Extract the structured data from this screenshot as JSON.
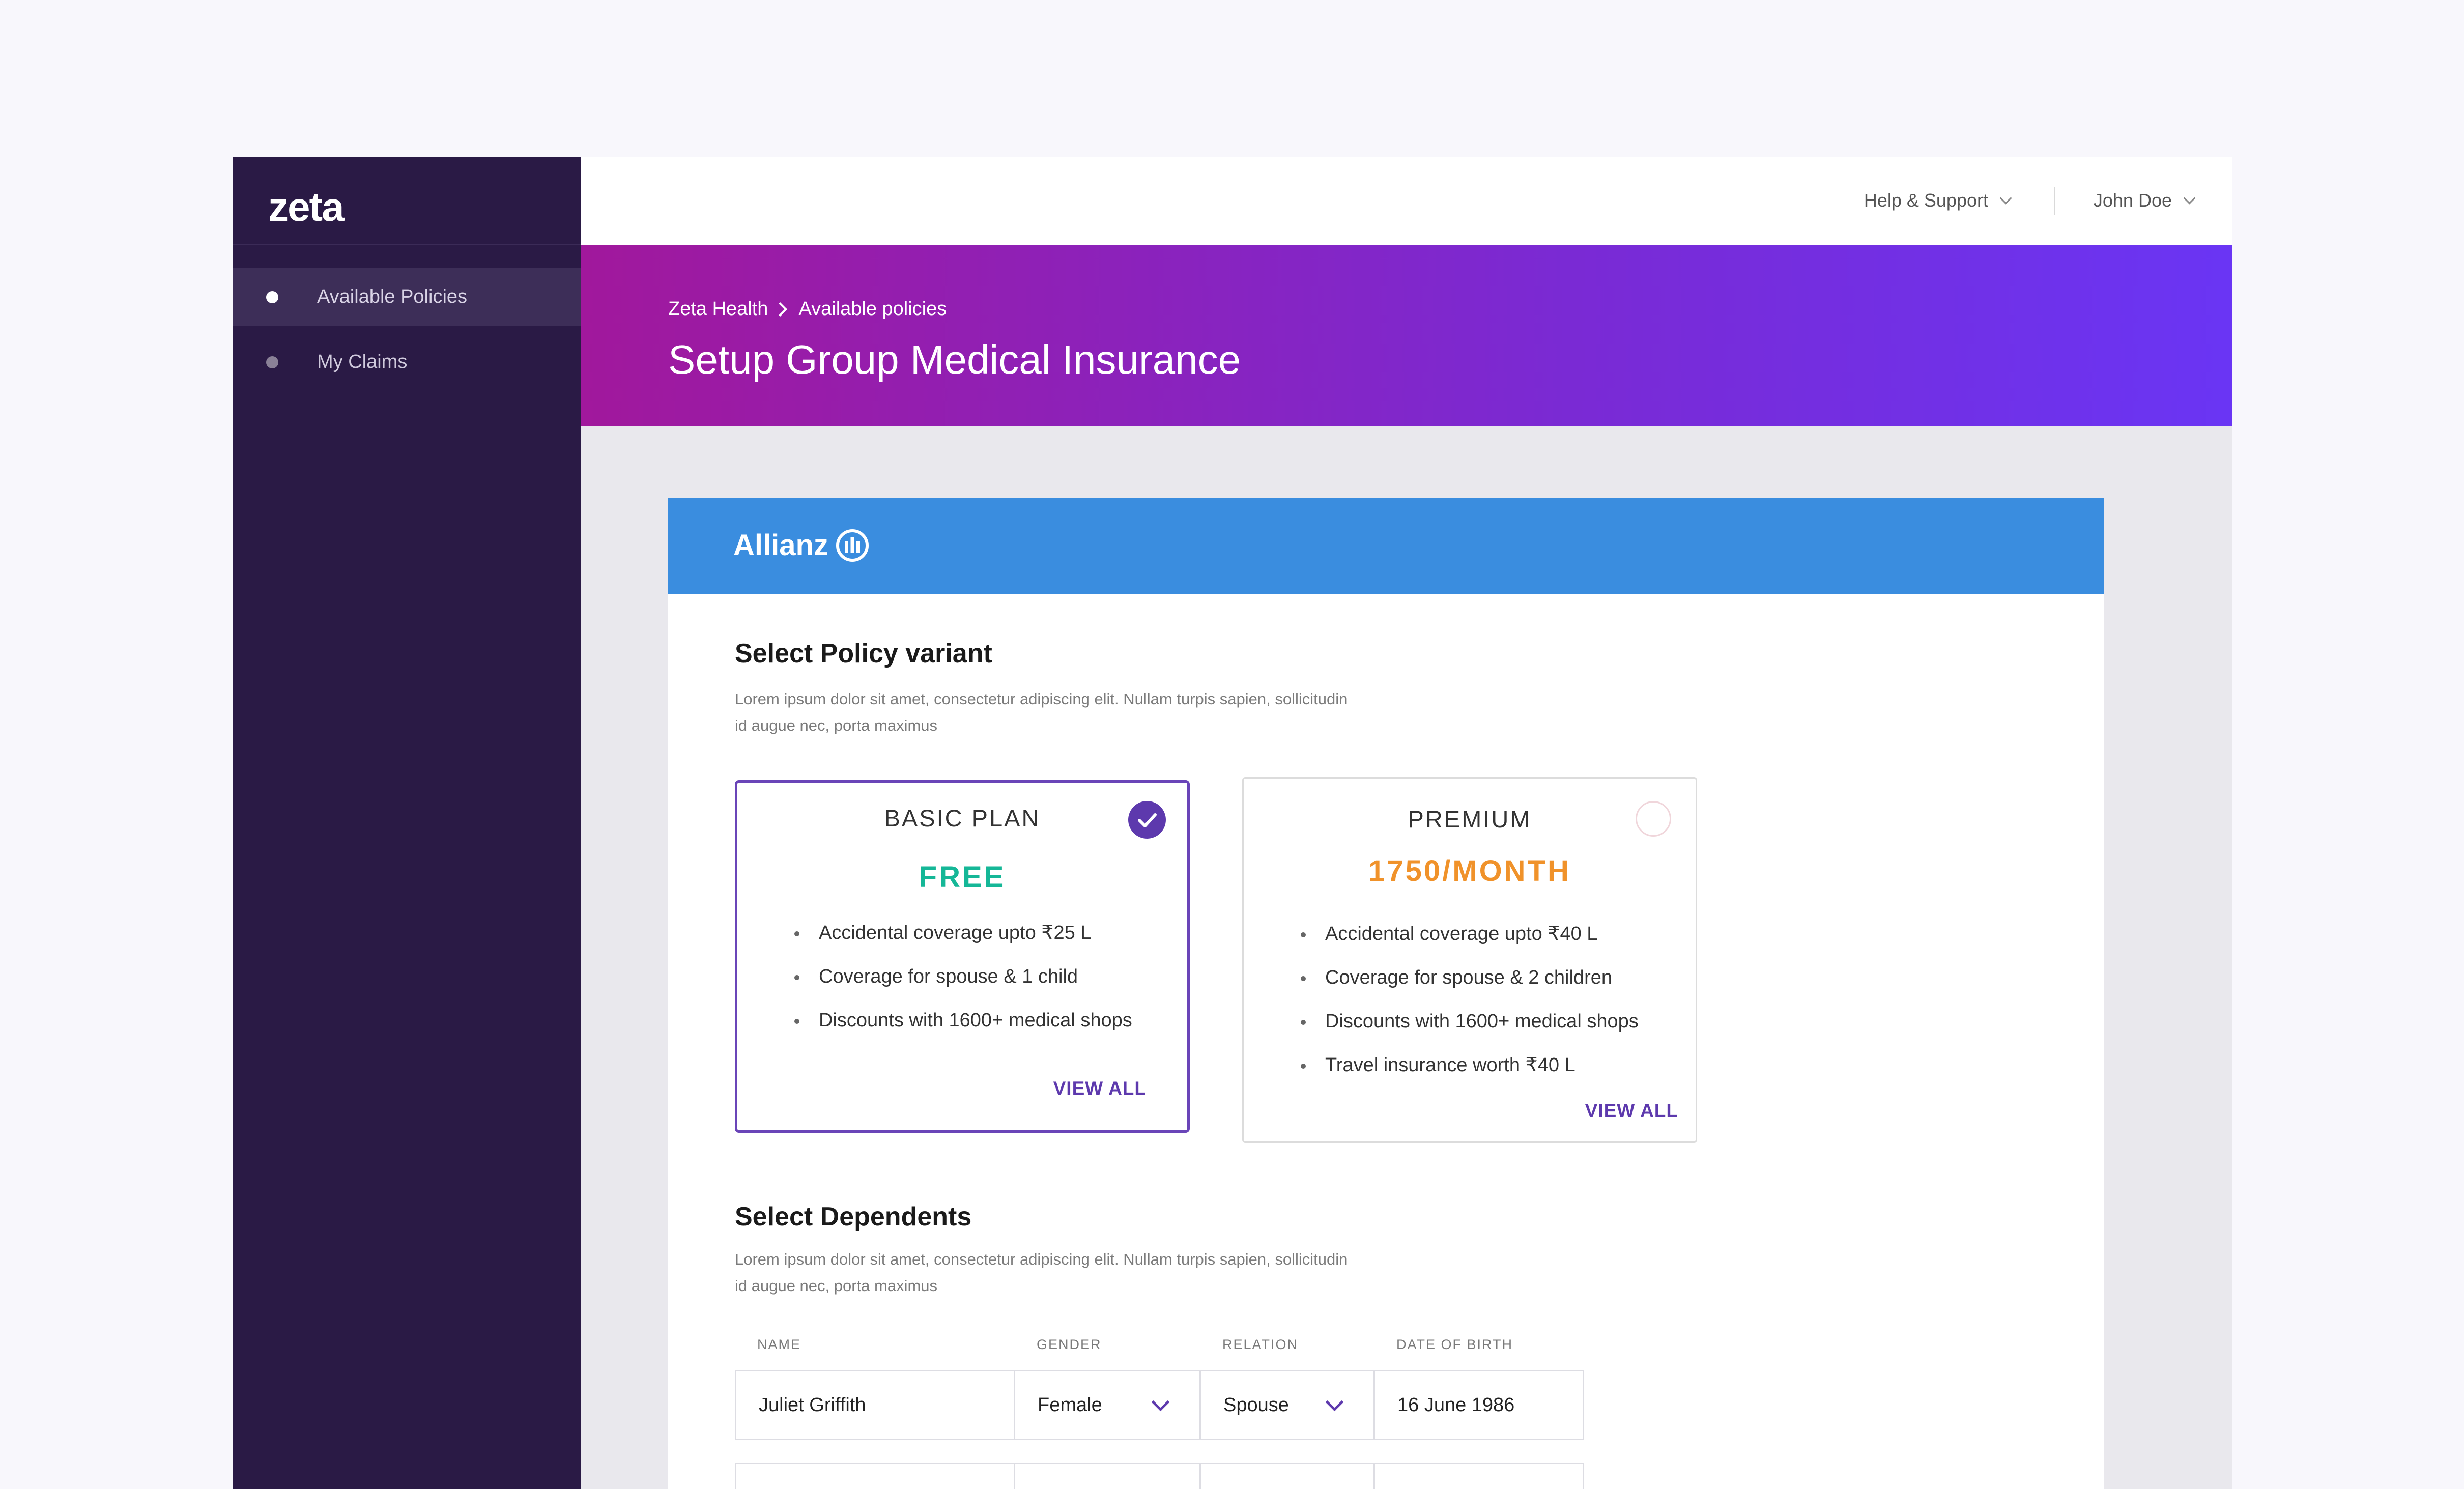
{
  "app": {
    "logo": "zeta"
  },
  "sidebar": {
    "items": [
      {
        "label": "Available Policies",
        "active": true
      },
      {
        "label": "My Claims",
        "active": false
      }
    ]
  },
  "topbar": {
    "help_label": "Help & Support",
    "user_label": "John Doe"
  },
  "banner": {
    "breadcrumb": [
      "Zeta Health",
      "Available policies"
    ],
    "title": "Setup  Group Medical Insurance"
  },
  "insurer": {
    "name": "Allianz"
  },
  "policy_section": {
    "title": "Select Policy variant",
    "description_line1": "Lorem ipsum dolor sit amet, consectetur adipiscing elit. Nullam turpis sapien, sollicitudin",
    "description_line2": "id augue nec, porta maximus"
  },
  "plans": [
    {
      "name": "BASIC PLAN",
      "price": "FREE",
      "price_color": "#15b797",
      "selected": true,
      "features": [
        "Accidental coverage upto ₹25 L",
        "Coverage for spouse & 1 child",
        "Discounts with 1600+ medical shops"
      ],
      "view_all": "VIEW ALL"
    },
    {
      "name": "PREMIUM",
      "price": "1750/MONTH",
      "price_color": "#f0922a",
      "selected": false,
      "features": [
        "Accidental coverage upto ₹40 L",
        "Coverage for spouse & 2 children",
        "Discounts with 1600+ medical shops",
        "Travel insurance worth ₹40 L"
      ],
      "view_all": "VIEW ALL"
    }
  ],
  "dependents_section": {
    "title": "Select Dependents",
    "description_line1": "Lorem ipsum dolor sit amet, consectetur adipiscing elit. Nullam turpis sapien, sollicitudin",
    "description_line2": "id augue nec, porta maximus",
    "columns": [
      "NAME",
      "GENDER",
      "RELATION",
      "DATE OF BIRTH"
    ],
    "rows": [
      {
        "name": "Juliet Griffith",
        "gender": "Female",
        "relation": "Spouse",
        "dob": "16 June 1986"
      },
      {
        "name": "",
        "gender": "",
        "relation": "",
        "dob": ""
      }
    ]
  },
  "colors": {
    "sidebar_bg": "#2a1a45",
    "accent": "#5d39ad",
    "banner_gradient_start": "#a1189c",
    "banner_gradient_end": "#6a35f4",
    "insurer_header": "#3a8ddf"
  }
}
